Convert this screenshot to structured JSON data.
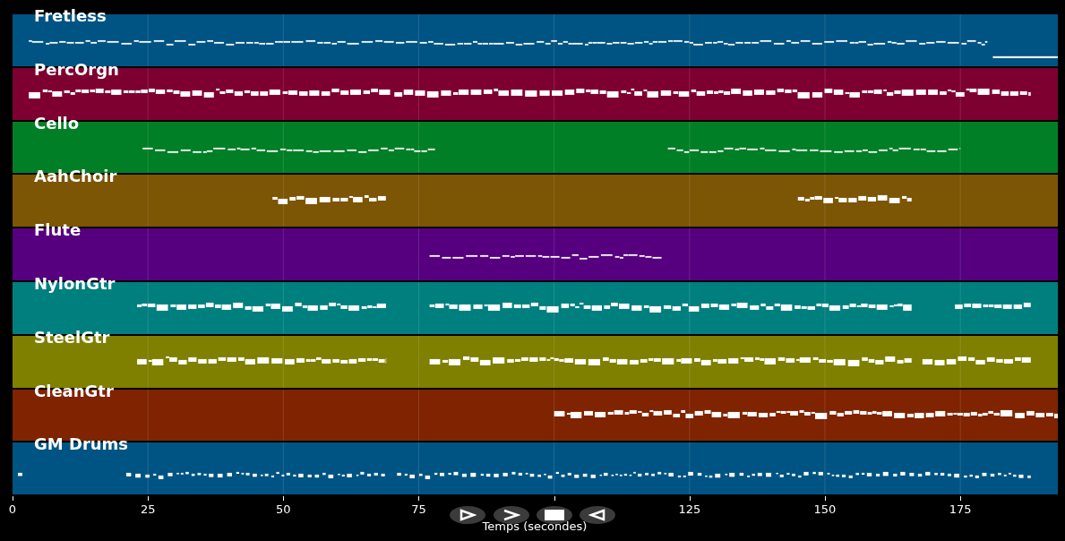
{
  "tracks": [
    {
      "name": "Fretless",
      "color": "#005483"
    },
    {
      "name": "PercOrgn",
      "color": "#7e0030"
    },
    {
      "name": "Cello",
      "color": "#007f26"
    },
    {
      "name": "AahChoir",
      "color": "#7c5505"
    },
    {
      "name": "Flute",
      "color": "#56007f"
    },
    {
      "name": "NylonGtr",
      "color": "#007f7f"
    },
    {
      "name": "SteelGtr",
      "color": "#7f7f00"
    },
    {
      "name": "CleanGtr",
      "color": "#7f2300"
    },
    {
      "name": "GM Drums",
      "color": "#005483"
    }
  ],
  "x_axis": {
    "ticks": [
      "0",
      "25",
      "50",
      "75",
      "125",
      "150",
      "175"
    ],
    "label": "Temps (secondes)"
  },
  "controls": [
    {
      "kind": "play"
    },
    {
      "kind": "next"
    },
    {
      "kind": "stop"
    },
    {
      "kind": "back"
    }
  ]
}
